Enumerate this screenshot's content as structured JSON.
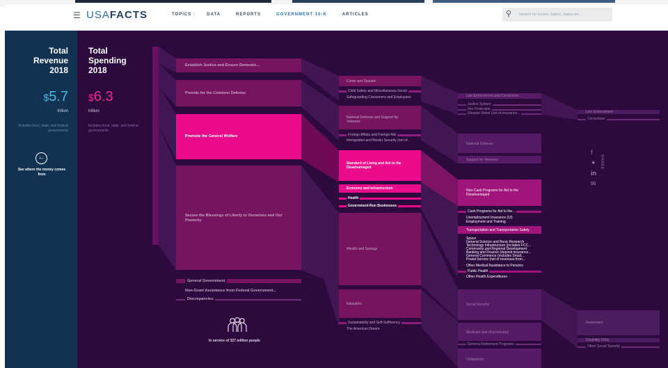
{
  "header": {
    "logo_light": "USA",
    "logo_bold": "FACTS",
    "nav": [
      "TOPICS",
      "DATA",
      "REPORTS",
      "GOVERNMENT 10-K",
      "ARTICLES"
    ],
    "search_placeholder": "Search for issues, topics, states etc...",
    "colors": {
      "accent": "#2c6cb0"
    }
  },
  "revenue": {
    "title_line1": "Total",
    "title_line2": "Revenue",
    "title_line3": "2018",
    "currency": "$",
    "amount": "5.7",
    "unit": "trillion",
    "note": "Includes local, state, and federal governments",
    "back_label": "See where the money comes from",
    "color": "#4fb9e5"
  },
  "spending": {
    "title_line1": "Total",
    "title_line2": "Spending",
    "title_line3": "2018",
    "currency": "$",
    "amount": "6.3",
    "unit": "trillion",
    "note": "Includes local, state, and federal governments",
    "color": "#ea2d8f"
  },
  "missions": [
    "Establish Justice and Ensure Domestic...",
    "Provide for the Common Defense",
    "Promote the General Welfare",
    "Secure the Blessings of Liberty to Ourselves and Our Posterity",
    "General Government",
    "Non-Grant Assistance from Federal Government...",
    "Discrepancies"
  ],
  "categories": {
    "crime": "Crime and Disaster",
    "child_safety": "Child Safety and Miscellaneous Social",
    "safeguarding": "Safeguarding Consumers and Employees",
    "defense": "National Defense and Support for Veterans",
    "foreign": "Foreign Affairs and Foreign Aid",
    "immigration": "Immigration and Border Security (net of...",
    "standard": "Standard of Living and Aid to the Disadvantaged",
    "economy": "Economy and Infrastructure",
    "health": "Health",
    "govrun": "Government-Run Businesses",
    "wealth": "Wealth and Savings",
    "education": "Education",
    "sustainability": "Sustainability and Self-Sufficiency",
    "dream": "The American Dream"
  },
  "subcategories": {
    "law": "Law Enforcement and Corrections",
    "justice": "Justice System",
    "fire": "Fire Protection",
    "disaster": "Disaster Relief (net of insurance...",
    "national_defense": "National Defense",
    "veterans": "Support for Veterans",
    "noncash": "Non-Cash Programs for Aid to the Disadvantaged",
    "cash": "Cash Programs for Aid to the...",
    "unemployment": "Unemployment Insurance (UI)",
    "employment": "Employment and Training",
    "transportation": "Transportation and Transportation Safety",
    "space": "Space",
    "science": "General Science and Basic Research",
    "technology": "Technology Infrastructure (includes FCC...",
    "community": "Community and Regional Development",
    "banking": "Banking and Finance (deposit insurance...",
    "commerce": "General Commerce (includes Small...",
    "postal": "Postal Service (net of revenues from...",
    "other_medical": "Other Medical Assistance to Persons",
    "public_health": "Public Health",
    "other_health": "Other Health Expenditures",
    "social_security": "Social Security",
    "medicare": "Medicare (net of premiums)",
    "retirement": "General Retirement Programs",
    "obligations": "Obligations"
  },
  "level4": {
    "law": "Law Enforcement",
    "corrections": "Corrections",
    "retirement": "Retirement",
    "disability": "Disability (SSI)",
    "other_social": "Other Social Security"
  },
  "share_label": "SHARE",
  "population_label": "In service of 327 million people"
}
